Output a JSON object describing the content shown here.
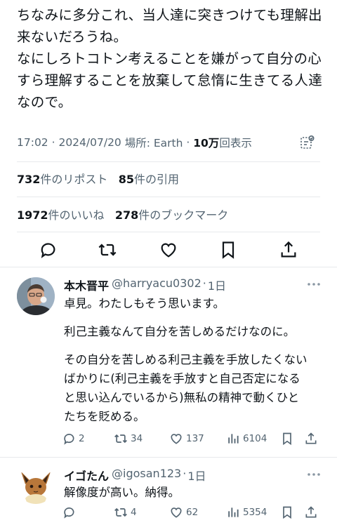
{
  "tweet": {
    "lines": [
      "ちなみに多分これ、当人達に突きつけても理解出",
      "来ないだろうね。",
      "なにしろトコトン考えることを嫌がって自分の心",
      "すら理解することを放棄して怠惰に生きてる人達",
      "なので。"
    ],
    "time": "17:02",
    "date": "2024/07/20",
    "place": "場所: Earth",
    "views_count": "10万",
    "views_label": "回表示"
  },
  "stats": {
    "reposts_count": "732",
    "reposts_label": "件のリポスト",
    "quotes_count": "85",
    "quotes_label": "件の引用",
    "likes_count": "1972",
    "likes_label": "件のいいね",
    "bookmarks_count": "278",
    "bookmarks_label": "件のブックマーク"
  },
  "icons": {
    "actions": [
      "reply-icon",
      "retweet-icon",
      "like-icon",
      "bookmark-icon",
      "share-icon"
    ],
    "reply_bar": [
      "reply-icon",
      "retweet-icon",
      "like-icon",
      "views-icon",
      "bookmark-icon",
      "share-icon"
    ],
    "other": [
      "grok-icon",
      "more-icon"
    ]
  },
  "colors": {
    "text": "#0f1419",
    "secondary": "#536471",
    "divider": "#e7e9ec"
  },
  "replies": [
    {
      "name": "本木晋平",
      "handle": "@harryacu0302",
      "time": "1日",
      "lines": [
        "卓見。わたしもそう思います。",
        "",
        "利己主義なんて自分を苦しめるだけなのに。",
        "",
        "その自分を苦しめる利己主義を手放したくない",
        "ばかりに(利己主義を手放すと自己否定になる",
        "と思い込んでいるから)無私の精神で動くひと",
        "たちを貶める。"
      ],
      "replies": "2",
      "reposts": "34",
      "likes": "137",
      "views": "6104"
    },
    {
      "name": "イゴたん",
      "handle": "@igosan123",
      "time": "1日",
      "lines": [
        "解像度が高い。納得。"
      ],
      "replies": "",
      "reposts": "4",
      "likes": "62",
      "views": "5354"
    }
  ]
}
